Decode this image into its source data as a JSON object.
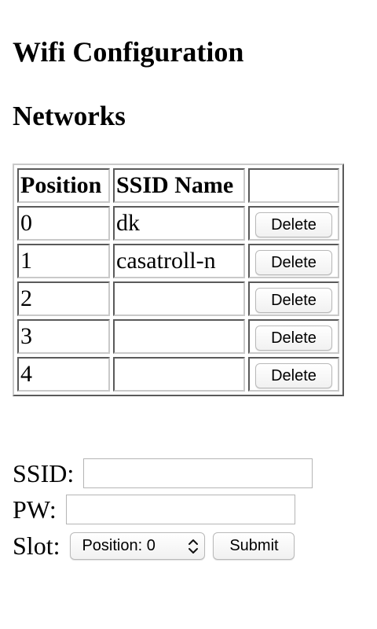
{
  "page": {
    "title": "Wifi Configuration",
    "section_title": "Networks"
  },
  "table": {
    "headers": [
      "Position",
      "SSID Name",
      ""
    ],
    "rows": [
      {
        "position": "0",
        "ssid": "dk",
        "action": "Delete"
      },
      {
        "position": "1",
        "ssid": "casatroll-n",
        "action": "Delete"
      },
      {
        "position": "2",
        "ssid": "",
        "action": "Delete"
      },
      {
        "position": "3",
        "ssid": "",
        "action": "Delete"
      },
      {
        "position": "4",
        "ssid": "",
        "action": "Delete"
      }
    ]
  },
  "form": {
    "ssid_label": "SSID:",
    "ssid_value": "",
    "pw_label": "PW:",
    "pw_value": "",
    "slot_label": "Slot:",
    "slot_selected": "Position: 0",
    "submit_label": "Submit"
  },
  "icons": {
    "select_arrows": "chevron-up-down-icon"
  }
}
